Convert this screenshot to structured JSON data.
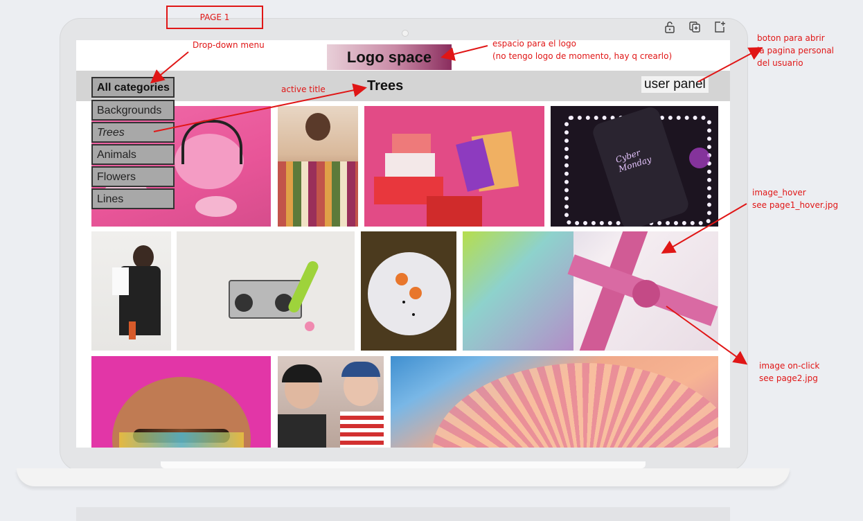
{
  "page_label": "PAGE 1",
  "app": {
    "logo_text": "Logo space",
    "active_title": "Trees",
    "user_panel": "user panel",
    "dropdown": {
      "header": "All categories",
      "items": [
        "Backgrounds",
        "Trees",
        "Animals",
        "Flowers",
        "Lines"
      ],
      "selected": "Trees"
    }
  },
  "toolbar_icons": [
    "lock-icon",
    "copy-icon",
    "add-page-icon"
  ],
  "annotations": {
    "dropdown": "Drop-down menu",
    "active_title": "active title",
    "logo": [
      "espacio para el logo",
      "(no tengo logo de momento, hay q crearlo)"
    ],
    "user_button": [
      "boton para abrir",
      "la pagina personal",
      "del usuario"
    ],
    "image_hover": [
      "image_hover",
      "see page1_hover.jpg"
    ],
    "image_click": [
      "image on-click",
      "see page2.jpg"
    ]
  },
  "gallery": [
    {
      "name": "pink-pumpkin-candy-image"
    },
    {
      "name": "clothing-rack-man-image"
    },
    {
      "name": "shopping-boxes-bags-image"
    },
    {
      "name": "cyber-monday-phone-image"
    },
    {
      "name": "waiter-pouring-image"
    },
    {
      "name": "retro-boombox-image"
    },
    {
      "name": "ghosts-halloween-image"
    },
    {
      "name": "pink-ribbon-gift-image"
    },
    {
      "name": "bald-head-makeup-image"
    },
    {
      "name": "friends-ice-cream-image"
    },
    {
      "name": "mushroom-gills-image"
    }
  ],
  "colors": {
    "annotation": "#e01616",
    "nav_bar": "#d4d4d4",
    "dropdown_bg": "#a8a8a8"
  }
}
